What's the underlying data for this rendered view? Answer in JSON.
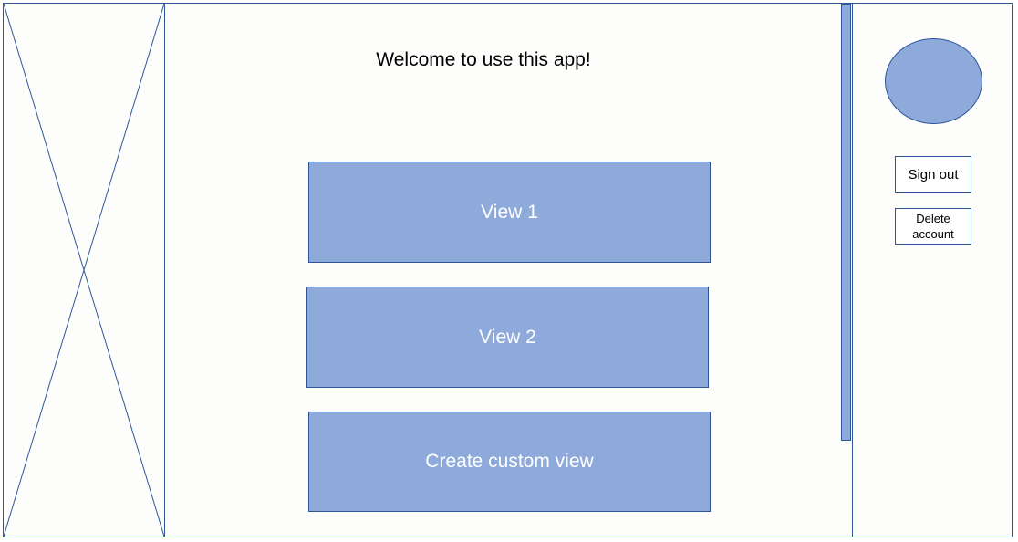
{
  "main": {
    "welcome_text": "Welcome to use this app!",
    "views": [
      {
        "label": "View 1"
      },
      {
        "label": "View 2"
      },
      {
        "label": "Create custom view"
      }
    ]
  },
  "account": {
    "sign_out_label": "Sign out",
    "delete_account_label": "Delete\naccount"
  },
  "colors": {
    "button_fill": "#8eaadb",
    "border": "#2f5597",
    "background": "#fdfdfb"
  }
}
